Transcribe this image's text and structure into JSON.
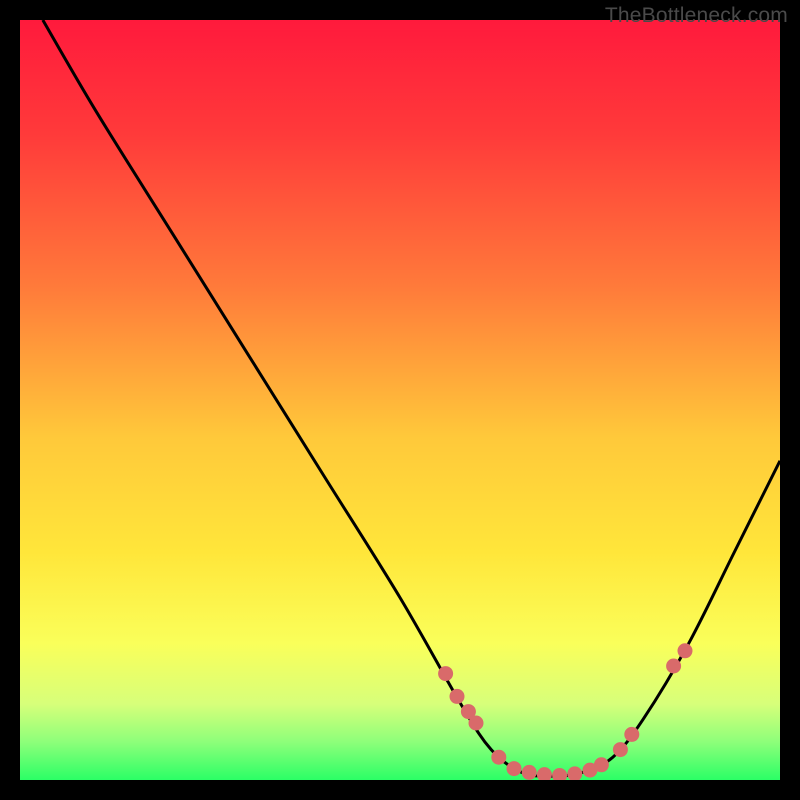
{
  "watermark": "TheBottleneck.com",
  "colors": {
    "frame": "#000000",
    "curve": "#000000",
    "marker_fill": "#d96a6a",
    "marker_stroke": "#c94f4f"
  },
  "chart_data": {
    "type": "line",
    "title": "",
    "xlabel": "",
    "ylabel": "",
    "xlim": [
      0,
      100
    ],
    "ylim": [
      0,
      100
    ],
    "series": [
      {
        "name": "bottleneck-curve",
        "x": [
          3,
          10,
          20,
          30,
          40,
          50,
          58,
          62,
          66,
          70,
          74,
          78,
          82,
          88,
          94,
          100
        ],
        "y": [
          100,
          88,
          72,
          56,
          40,
          24,
          10,
          4,
          1,
          0.5,
          1,
          3,
          8,
          18,
          30,
          42
        ]
      }
    ],
    "markers": {
      "name": "highlighted-points",
      "x": [
        56,
        57.5,
        59,
        60,
        63,
        65,
        67,
        69,
        71,
        73,
        75,
        76.5,
        79,
        80.5,
        86,
        87.5
      ],
      "y": [
        14,
        11,
        9,
        7.5,
        3,
        1.5,
        1,
        0.7,
        0.6,
        0.8,
        1.3,
        2,
        4,
        6,
        15,
        17
      ]
    },
    "gradient_stops": [
      {
        "offset": 0.0,
        "color": "#ff1a3c"
      },
      {
        "offset": 0.15,
        "color": "#ff3a3a"
      },
      {
        "offset": 0.35,
        "color": "#ff7a3a"
      },
      {
        "offset": 0.55,
        "color": "#ffc93a"
      },
      {
        "offset": 0.7,
        "color": "#ffe63a"
      },
      {
        "offset": 0.82,
        "color": "#faff5a"
      },
      {
        "offset": 0.9,
        "color": "#d7ff7a"
      },
      {
        "offset": 0.95,
        "color": "#8dff7a"
      },
      {
        "offset": 1.0,
        "color": "#2bff66"
      }
    ]
  }
}
